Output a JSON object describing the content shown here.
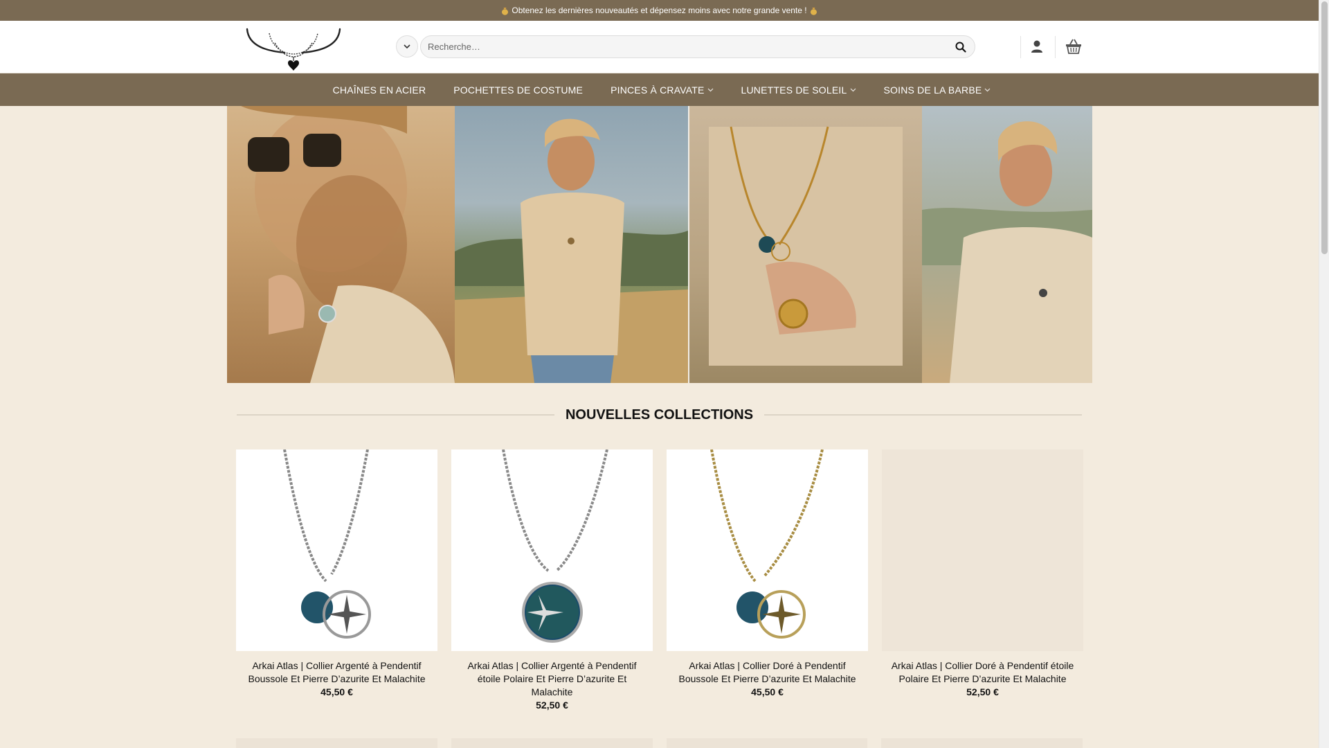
{
  "promo": {
    "text": "Obtenez les dernières nouveautés et dépensez moins avec notre grande vente !",
    "icon": "money-bag-icon"
  },
  "search": {
    "placeholder": "Recherche…"
  },
  "nav": {
    "items": [
      {
        "label": "CHAÎNES EN ACIER",
        "has_dropdown": false
      },
      {
        "label": "POCHETTES DE COSTUME",
        "has_dropdown": false
      },
      {
        "label": "PINCES À CRAVATE",
        "has_dropdown": true
      },
      {
        "label": "LUNETTES DE SOLEIL",
        "has_dropdown": true
      },
      {
        "label": "SOINS DE LA BARBE",
        "has_dropdown": true
      }
    ]
  },
  "collections": {
    "title": "NOUVELLES COLLECTIONS",
    "products": [
      {
        "name": "Arkai Atlas | Collier Argenté à Pendentif Boussole Et Pierre D’azurite Et Malachite",
        "price": "45,50 €"
      },
      {
        "name": "Arkai Atlas | Collier Argenté à Pendentif étoile Polaire Et Pierre D’azurite Et Malachite",
        "price": "52,50 €"
      },
      {
        "name": "Arkai Atlas | Collier Doré à Pendentif Boussole Et Pierre D’azurite Et Malachite",
        "price": "45,50 €"
      },
      {
        "name": "Arkai Atlas | Collier Doré à Pendentif étoile Polaire Et Pierre D’azurite Et Malachite",
        "price": "52,50 €"
      }
    ]
  },
  "colors": {
    "brand_brown": "#7a6a53",
    "page_bg": "#f3ebde"
  }
}
